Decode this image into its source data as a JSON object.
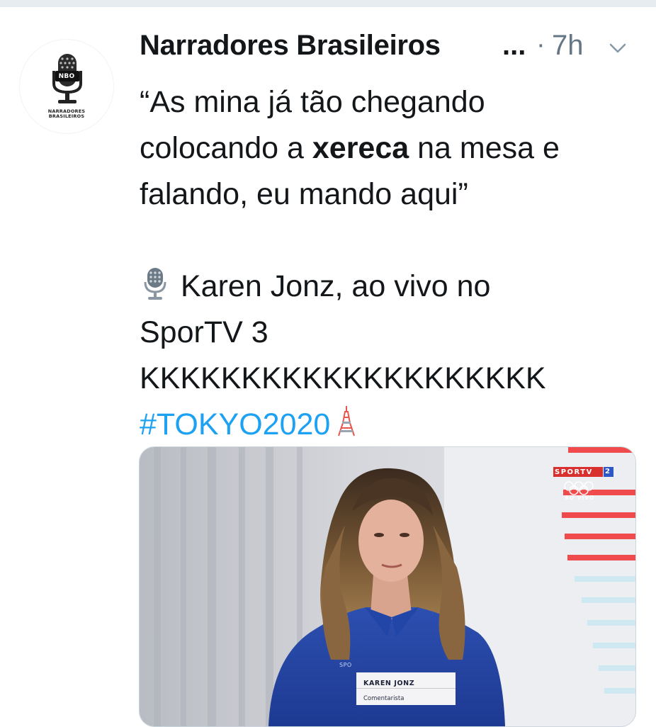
{
  "tweet": {
    "author_name": "Narradores Brasileiros",
    "name_truncation": "...",
    "separator": "·",
    "time": "7h",
    "avatar": {
      "initials": "NBO",
      "caption_line1": "NARRADORES",
      "caption_line2": "BRASILEIROS"
    },
    "text": {
      "line1": "“As mina já tão chegando",
      "line2_before": "colocando a ",
      "line2_bold": "xereca",
      "line2_after": " na mesa e",
      "line3": "falando, eu mando aqui”",
      "line4": "Karen Jonz, ao vivo no",
      "line5": "SporTV 3",
      "line6": "KKKKKKKKKKKKKKKKKKKK",
      "hashtag": "#TOKYO2020"
    },
    "icons": {
      "caret": "chevron-down-icon",
      "microphone": "microphone-emoji",
      "tower": "tokyo-tower-emoji"
    },
    "media": {
      "channel_logo": "SPORTV",
      "channel_number": "2",
      "live_label": "AO VIVO",
      "lower_third_name": "KAREN JONZ",
      "lower_third_role": "Comentarista",
      "shirt_text": "SPO"
    }
  },
  "colors": {
    "text": "#14171a",
    "muted": "#657786",
    "hashtag": "#1da1f2",
    "top_bar": "#e6ecf0"
  }
}
